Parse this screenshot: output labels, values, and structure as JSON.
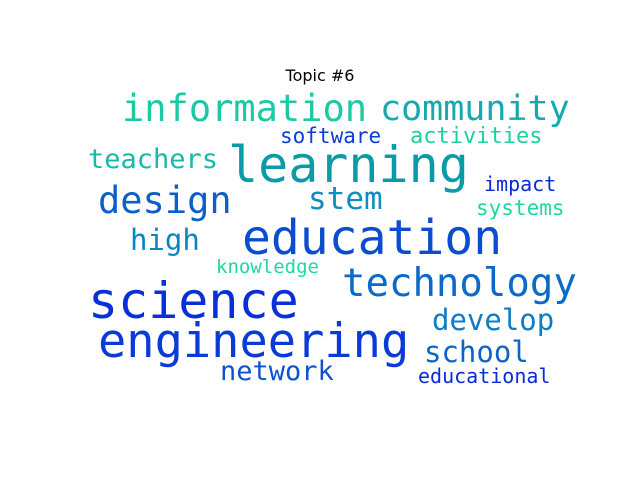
{
  "title": "Topic #6",
  "chart_data": {
    "type": "wordcloud",
    "title": "Topic #6",
    "words": [
      {
        "text": "science",
        "weight": 1.0,
        "color": "#0a2fd9"
      },
      {
        "text": "education",
        "weight": 0.97,
        "color": "#0b4cd0"
      },
      {
        "text": "learning",
        "weight": 0.95,
        "color": "#0b9aa8"
      },
      {
        "text": "engineering",
        "weight": 0.93,
        "color": "#0a3bd8"
      },
      {
        "text": "technology",
        "weight": 0.78,
        "color": "#0b6ac8"
      },
      {
        "text": "information",
        "weight": 0.76,
        "color": "#1cc9a4"
      },
      {
        "text": "community",
        "weight": 0.74,
        "color": "#16a9b0"
      },
      {
        "text": "design",
        "weight": 0.72,
        "color": "#0b5fc8"
      },
      {
        "text": "develop",
        "weight": 0.62,
        "color": "#0c7cc6"
      },
      {
        "text": "stem",
        "weight": 0.62,
        "color": "#0d8ec0"
      },
      {
        "text": "school",
        "weight": 0.58,
        "color": "#0b65c9"
      },
      {
        "text": "teachers",
        "weight": 0.55,
        "color": "#17b9aa"
      },
      {
        "text": "high",
        "weight": 0.55,
        "color": "#0c84c4"
      },
      {
        "text": "network",
        "weight": 0.52,
        "color": "#0b53cf"
      },
      {
        "text": "activities",
        "weight": 0.44,
        "color": "#1ccfa1"
      },
      {
        "text": "software",
        "weight": 0.42,
        "color": "#0b3ed6"
      },
      {
        "text": "impact",
        "weight": 0.42,
        "color": "#0a2ad8"
      },
      {
        "text": "systems",
        "weight": 0.4,
        "color": "#1fd6a0"
      },
      {
        "text": "educational",
        "weight": 0.4,
        "color": "#0a2ad9"
      },
      {
        "text": "knowledge",
        "weight": 0.38,
        "color": "#1ed9a0"
      }
    ]
  }
}
